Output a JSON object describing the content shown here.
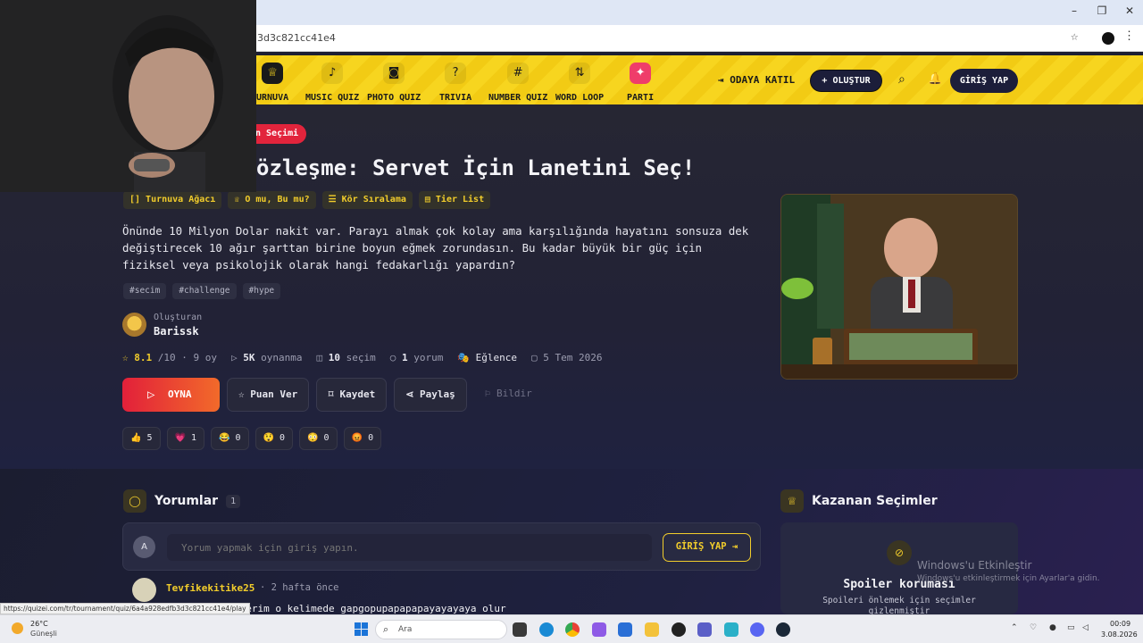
{
  "browser": {
    "url": "3d3c821cc41e4",
    "controls": {
      "minimize": "–",
      "restore": "❐",
      "close": "✕"
    }
  },
  "nav": {
    "items": [
      {
        "label": "URNUVA",
        "icon": "trophy-icon",
        "glyph": "♕"
      },
      {
        "label": "MUSIC QUIZ",
        "icon": "music-note-icon",
        "glyph": "♪"
      },
      {
        "label": "PHOTO QUIZ",
        "icon": "camera-icon",
        "glyph": "◙"
      },
      {
        "label": "TRIVIA",
        "icon": "question-icon",
        "glyph": "?"
      },
      {
        "label": "NUMBER QUIZ",
        "icon": "hash-icon",
        "glyph": "#"
      },
      {
        "label": "WORD LOOP",
        "icon": "sort-icon",
        "glyph": "⇅"
      },
      {
        "label": "PARTI",
        "icon": "party-icon",
        "glyph": "✦"
      }
    ],
    "join_label": "⇥ ODAYA KATIL",
    "create_label": "+ OLUŞTUR",
    "login_label": "GİRİŞ YAP"
  },
  "quiz": {
    "category": "n Seçimi",
    "title": "özleşme: Servet İçin Lanetini Seç!",
    "quicklinks": [
      "[] Turnuva Ağacı",
      "♕ O mu, Bu mu?",
      "☰ Kör Sıralama",
      "▤ Tier List"
    ],
    "description": "Önünde 10 Milyon Dolar nakit var. Parayı almak çok kolay ama karşılığında hayatını sonsuza dek değiştirecek 10 ağır şarttan birine boyun eğmek zorundasın. Bu kadar büyük bir güç için fiziksel veya psikolojik olarak hangi fedakarlığı yapardın?",
    "tags": [
      "#secim",
      "#challenge",
      "#hype"
    ],
    "creator_label": "Oluşturan",
    "creator_name": "Barissk",
    "rating": "8.1",
    "rating_suffix": "/10 · 9 oy",
    "plays": "5K",
    "plays_suffix": "oynanma",
    "choices": "10",
    "choices_suffix": "seçim",
    "comments_count": "1",
    "comments_suffix": "yorum",
    "category_name": "Eğlence",
    "date": "5 Tem 2026",
    "actions": {
      "play": "OYNA",
      "rate": "☆ Puan Ver",
      "save": "⌑ Kaydet",
      "share": "⋖ Paylaş",
      "report": "⚐ Bildir"
    },
    "reactions": [
      {
        "emoji": "👍",
        "count": "5"
      },
      {
        "emoji": "💗",
        "count": "1"
      },
      {
        "emoji": "😂",
        "count": "0"
      },
      {
        "emoji": "😲",
        "count": "0"
      },
      {
        "emoji": "😳",
        "count": "0"
      },
      {
        "emoji": "😡",
        "count": "0"
      }
    ]
  },
  "comments": {
    "title": "Yorumlar",
    "count": "1",
    "input_avatar": "A",
    "placeholder": "Yorum yapmak için giriş yapın.",
    "login_button": "GİRİŞ YAP ⇥",
    "first": {
      "user": "Tevfikekitike25",
      "time": "· 2 hafta önce",
      "text": "eçerim o kelimede gapgopupapapapayayayaya olur"
    }
  },
  "winners": {
    "title": "Kazanan Seçimler",
    "spoiler_title": "Spoiler koruması",
    "spoiler_text": "Spoileri önlemek için seçimler gizlenmiştir"
  },
  "watermark": {
    "line1": "Windows'u Etkinleştir",
    "line2": "Windows'u etkinleştirmek için Ayarlar'a gidin."
  },
  "status_url": "https://quizei.com/tr/tournament/quiz/6a4a928edfb3d3c821cc41e4/play",
  "taskbar": {
    "temperature": "26°C",
    "weather": "Güneşli",
    "search_placeholder": "Ara",
    "time": "00:09",
    "date": "3.08.2026"
  }
}
